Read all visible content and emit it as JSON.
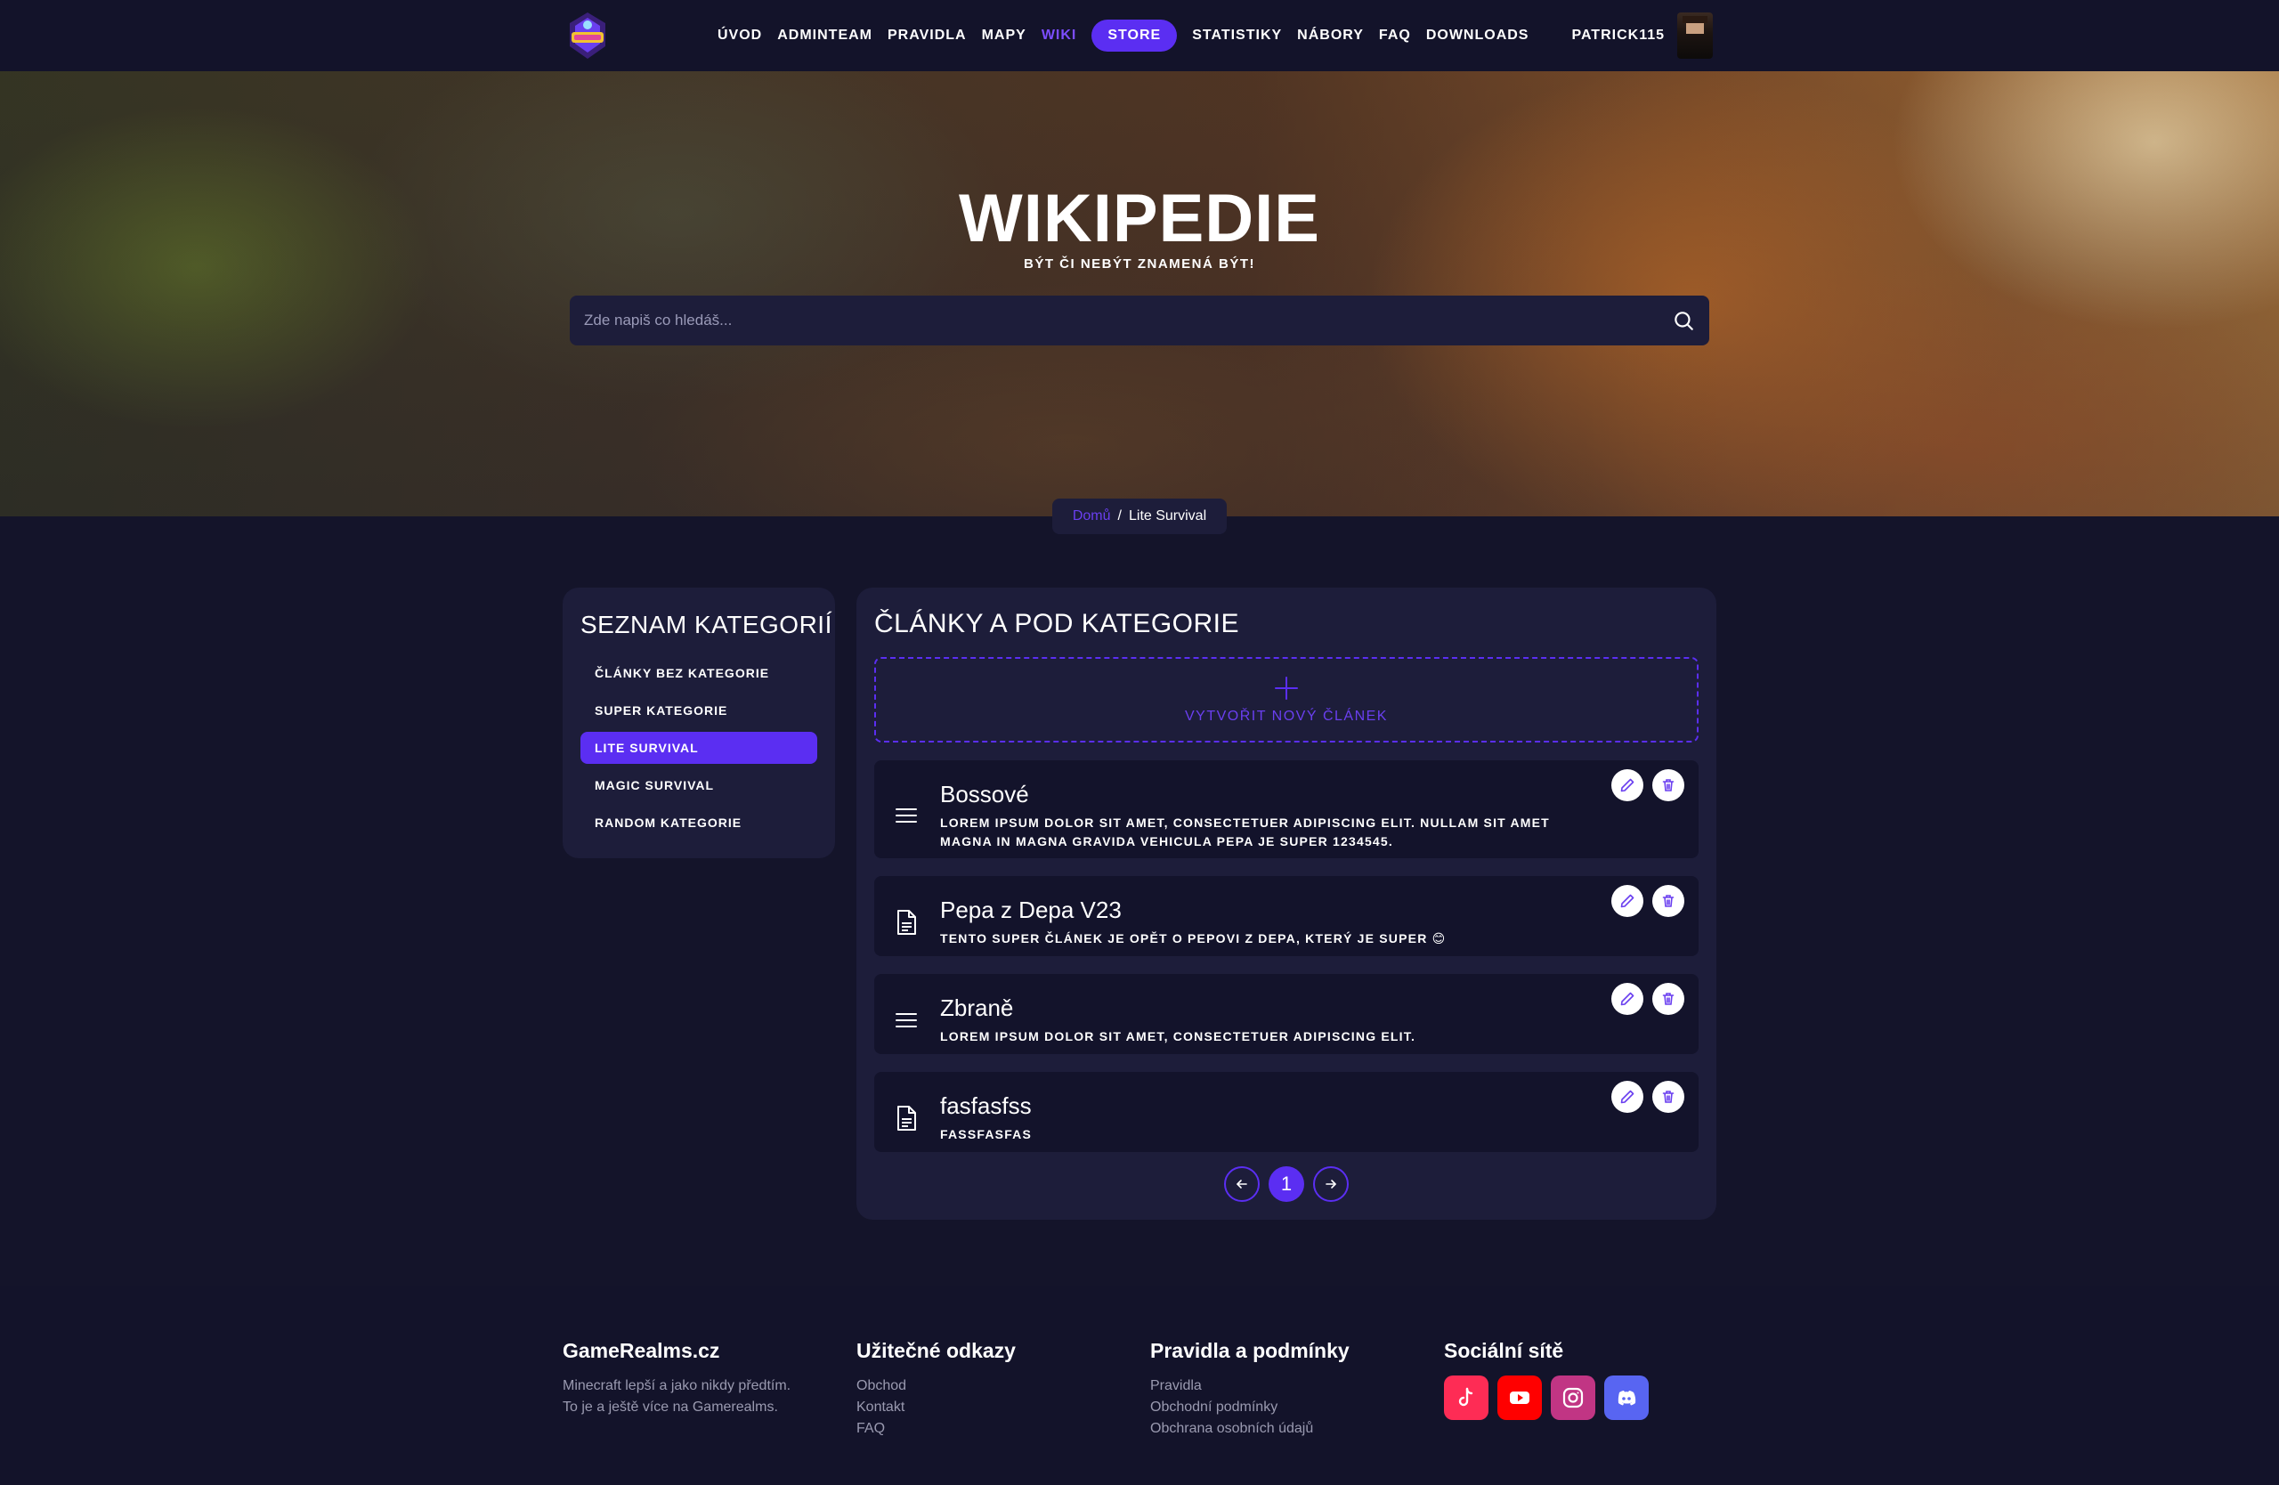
{
  "nav": {
    "items": [
      {
        "label": "Úvod",
        "active": false
      },
      {
        "label": "Adminteam",
        "active": false
      },
      {
        "label": "Pravidla",
        "active": false
      },
      {
        "label": "Mapy",
        "active": false
      },
      {
        "label": "Wiki",
        "active": true
      }
    ],
    "store_label": "Store",
    "items_after": [
      {
        "label": "Statistiky"
      },
      {
        "label": "Nábory"
      },
      {
        "label": "FAQ"
      },
      {
        "label": "Downloads"
      }
    ],
    "username": "PATRICK115"
  },
  "hero": {
    "title": "WIKIPEDIE",
    "subtitle": "BÝT ČI NEBÝT ZNAMENÁ BÝT!",
    "search_placeholder": "Zde napiš co hledáš..."
  },
  "breadcrumb": {
    "home": "Domů",
    "separator": "/",
    "current": "Lite Survival"
  },
  "sidebar": {
    "title": "SEZNAM KATEGORIÍ",
    "items": [
      {
        "label": "ČLÁNKY BEZ KATEGORIE",
        "active": false
      },
      {
        "label": "SUPER KATEGORIE",
        "active": false
      },
      {
        "label": "LITE SURVIVAL",
        "active": true
      },
      {
        "label": "MAGIC SURVIVAL",
        "active": false
      },
      {
        "label": "RANDOM KATEGORIE",
        "active": false
      }
    ]
  },
  "main": {
    "title": "ČLÁNKY A POD KATEGORIE",
    "new_article_label": "VYTVOŘIT NOVÝ ČLÁNEK",
    "articles": [
      {
        "icon": "menu-lines-icon",
        "title": "Bossové",
        "desc": "Lorem ipsum dolor sit amet, consectetuer adipiscing elit. Nullam sit amet magna in magna gravida vehicula pepa je super 1234545."
      },
      {
        "icon": "document-icon",
        "title": "Pepa z Depa V23",
        "desc": "Tento super článek je opět o Pepovi z Depa, který je super 😊"
      },
      {
        "icon": "menu-lines-icon",
        "title": "Zbraně",
        "desc": "Lorem ipsum dolor sit amet, consectetuer adipiscing elit."
      },
      {
        "icon": "document-icon",
        "title": "fasfasfss",
        "desc": "fassfasfas"
      }
    ],
    "pagination": {
      "current": "1"
    }
  },
  "footer": {
    "col1": {
      "title": "GameRealms.cz",
      "lines": [
        "Minecraft lepší a jako nikdy předtím.",
        "To je a ještě více na Gamerealms."
      ]
    },
    "col2": {
      "title": "Užitečné odkazy",
      "links": [
        "Obchod",
        "Kontakt",
        "FAQ"
      ]
    },
    "col3": {
      "title": "Pravidla a podmínky",
      "links": [
        "Pravidla",
        "Obchodní podmínky",
        "Obchrana osobních údajů"
      ]
    },
    "col4": {
      "title": "Sociální sítě",
      "socials": [
        {
          "name": "tiktok-icon",
          "color": "#fe2c55"
        },
        {
          "name": "youtube-icon",
          "color": "#ff0000"
        },
        {
          "name": "instagram-icon",
          "color": "#c13584"
        },
        {
          "name": "discord-icon",
          "color": "#5865f2"
        }
      ]
    }
  },
  "colors": {
    "accent": "#5b2ef2",
    "panel": "#1d1d3a",
    "background": "#14142a"
  }
}
